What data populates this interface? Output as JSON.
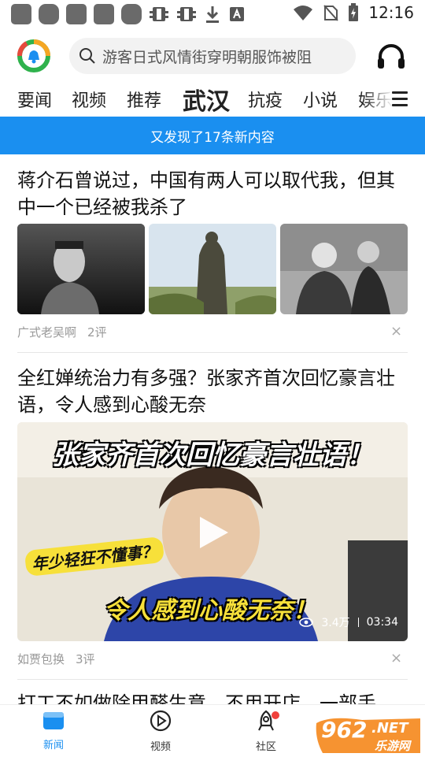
{
  "status_bar": {
    "time": "12:16"
  },
  "search": {
    "placeholder": "游客日式风情街穿明朝服饰被阻"
  },
  "tabs": [
    {
      "label": "要闻"
    },
    {
      "label": "视频"
    },
    {
      "label": "推荐"
    },
    {
      "label": "武汉",
      "active": true
    },
    {
      "label": "抗疫"
    },
    {
      "label": "小说"
    },
    {
      "label": "娱乐"
    }
  ],
  "banner": {
    "text": "又发现了17条新内容"
  },
  "articles": [
    {
      "title": "蒋介石曾说过，中国有两人可以取代我，但其中一个已经被我杀了",
      "source": "广式老吴啊",
      "comments": "2评",
      "close": "×"
    },
    {
      "title": "全红婵统治力有多强？张家齐首次回忆豪言壮语，令人感到心酸无奈",
      "source": "如贾包换",
      "comments": "3评",
      "close": "×",
      "video": {
        "caption_top": "张家齐首次回忆豪言壮语！",
        "caption_mid": "年少轻狂不懂事？",
        "caption_bottom": "令人感到心酸无奈！",
        "views": "3.4万",
        "duration": "03:34"
      }
    },
    {
      "title": "打工不如做除甲醛生意，不用开店，一部手"
    }
  ],
  "bottom_nav": [
    {
      "label": "新闻",
      "active": true
    },
    {
      "label": "视频"
    },
    {
      "label": "社区"
    }
  ],
  "watermark": {
    "number": "962",
    "suffix": ".NET",
    "site": "乐游网"
  },
  "colors": {
    "accent": "#1a8ff0",
    "badge_red": "#f0413c",
    "logo_green": "#2fb24c",
    "logo_orange": "#f5a623"
  }
}
